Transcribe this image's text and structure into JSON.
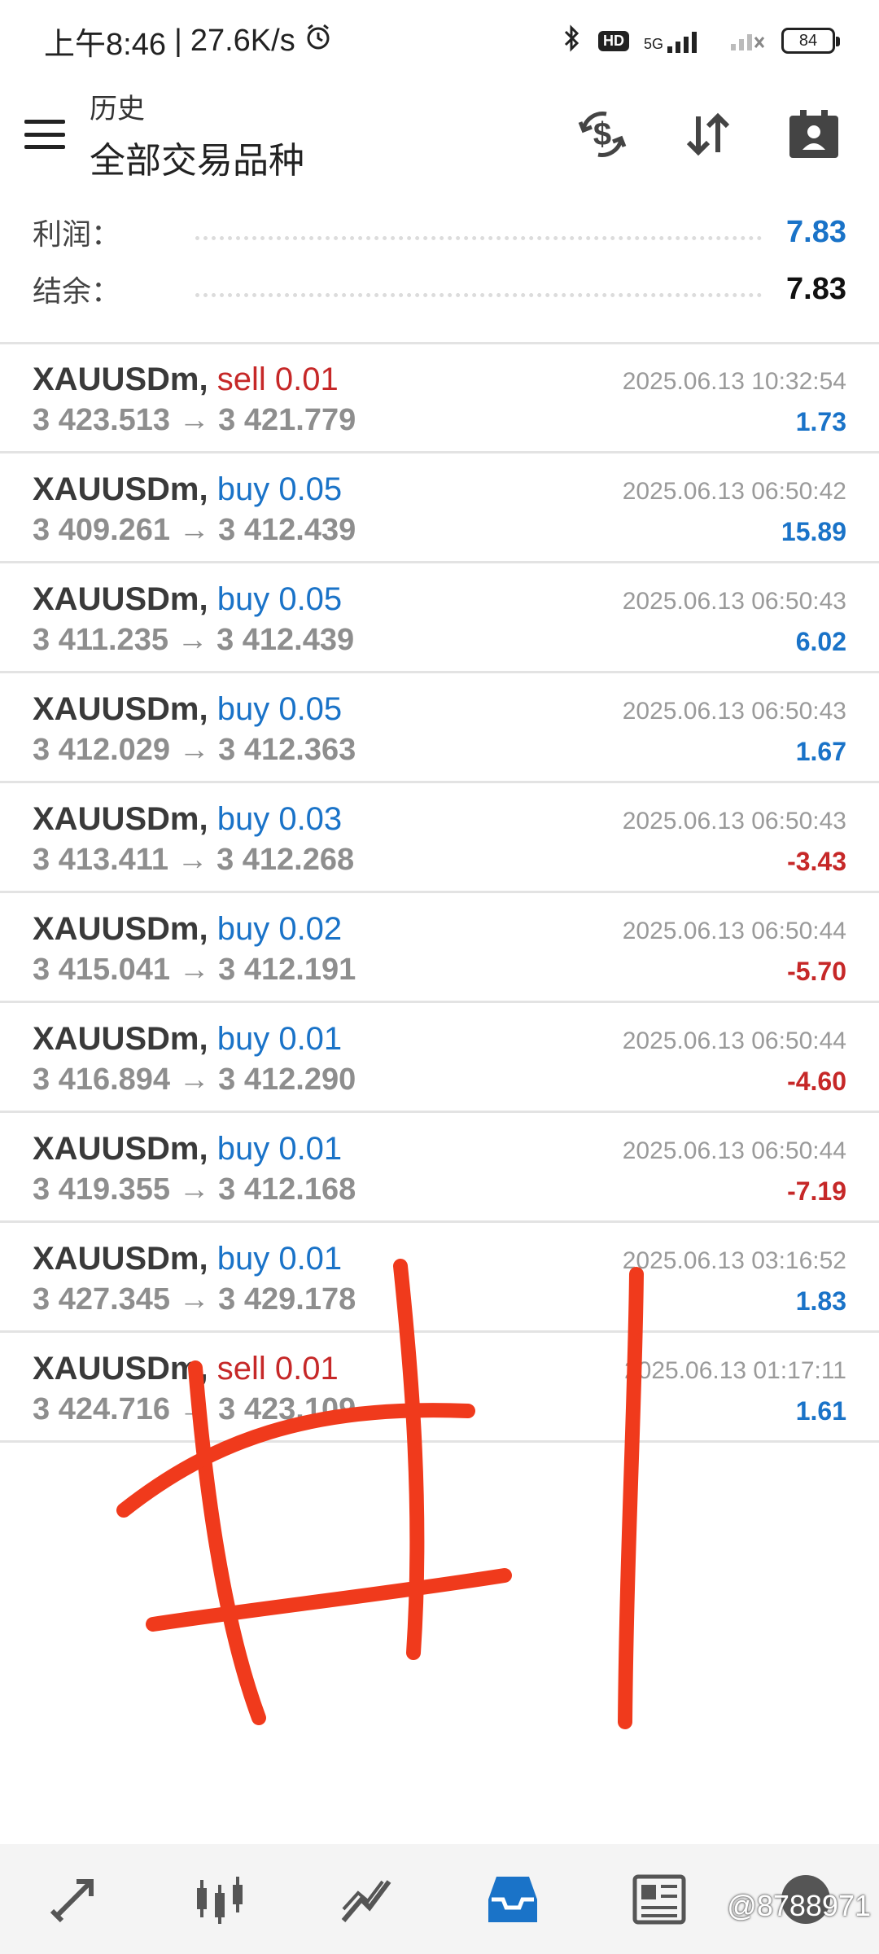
{
  "status_bar": {
    "time": "上午8:46",
    "net_speed": "27.6K/s",
    "network": "5G",
    "hd": "HD",
    "battery": "84"
  },
  "header": {
    "subtitle": "历史",
    "title": "全部交易品种"
  },
  "summary": {
    "profit_label": "利润：",
    "profit_value": "7.83",
    "balance_label": "结余：",
    "balance_value": "7.83"
  },
  "trades": [
    {
      "symbol": "XAUUSDm,",
      "side": "sell 0.01",
      "side_type": "sell",
      "prices": "3 423.513 → 3 421.779",
      "time": "2025.06.13 10:32:54",
      "pnl": "1.73",
      "pnl_sign": "pos"
    },
    {
      "symbol": "XAUUSDm,",
      "side": "buy 0.05",
      "side_type": "buy",
      "prices": "3 409.261 → 3 412.439",
      "time": "2025.06.13 06:50:42",
      "pnl": "15.89",
      "pnl_sign": "pos"
    },
    {
      "symbol": "XAUUSDm,",
      "side": "buy 0.05",
      "side_type": "buy",
      "prices": "3 411.235 → 3 412.439",
      "time": "2025.06.13 06:50:43",
      "pnl": "6.02",
      "pnl_sign": "pos"
    },
    {
      "symbol": "XAUUSDm,",
      "side": "buy 0.05",
      "side_type": "buy",
      "prices": "3 412.029 → 3 412.363",
      "time": "2025.06.13 06:50:43",
      "pnl": "1.67",
      "pnl_sign": "pos"
    },
    {
      "symbol": "XAUUSDm,",
      "side": "buy 0.03",
      "side_type": "buy",
      "prices": "3 413.411 → 3 412.268",
      "time": "2025.06.13 06:50:43",
      "pnl": "-3.43",
      "pnl_sign": "neg"
    },
    {
      "symbol": "XAUUSDm,",
      "side": "buy 0.02",
      "side_type": "buy",
      "prices": "3 415.041 → 3 412.191",
      "time": "2025.06.13 06:50:44",
      "pnl": "-5.70",
      "pnl_sign": "neg"
    },
    {
      "symbol": "XAUUSDm,",
      "side": "buy 0.01",
      "side_type": "buy",
      "prices": "3 416.894 → 3 412.290",
      "time": "2025.06.13 06:50:44",
      "pnl": "-4.60",
      "pnl_sign": "neg"
    },
    {
      "symbol": "XAUUSDm,",
      "side": "buy 0.01",
      "side_type": "buy",
      "prices": "3 419.355 → 3 412.168",
      "time": "2025.06.13 06:50:44",
      "pnl": "-7.19",
      "pnl_sign": "neg"
    },
    {
      "symbol": "XAUUSDm,",
      "side": "buy 0.01",
      "side_type": "buy",
      "prices": "3 427.345 → 3 429.178",
      "time": "2025.06.13 03:16:52",
      "pnl": "1.83",
      "pnl_sign": "pos"
    },
    {
      "symbol": "XAUUSDm,",
      "side": "sell 0.01",
      "side_type": "sell",
      "prices": "3 424.716 → 3 423.109",
      "time": "2025.06.13 01:17:11",
      "pnl": "1.61",
      "pnl_sign": "pos"
    }
  ],
  "nav": {
    "items": [
      "trade-icon",
      "quotes-icon",
      "chart-icon",
      "history-icon",
      "news-icon",
      "chat-icon"
    ],
    "active": "history-icon"
  },
  "watermark": "@8788971",
  "colors": {
    "accent": "#1a73c8",
    "loss": "#c62828",
    "annotation": "#f03a1c"
  }
}
